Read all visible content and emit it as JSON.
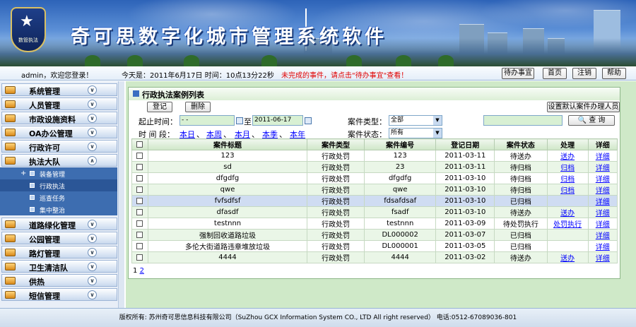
{
  "header": {
    "app_title": "奇可思数字化城市管理系统软件",
    "badge_text": "数管执法"
  },
  "topbar": {
    "welcome": "admin，欢迎您登录！",
    "date_text": "今天是：2011年6月17日  时间：10点13分22秒",
    "notice": "未完成的事件，请点击\"待办事宜\"查看！",
    "btn_todo": "待办事宜",
    "btn_home": "首页",
    "btn_logout": "注销",
    "btn_help": "帮助"
  },
  "sidebar": {
    "items": [
      {
        "label": "系统管理"
      },
      {
        "label": "人员管理"
      },
      {
        "label": "市政设施资料"
      },
      {
        "label": "OA办公管理"
      },
      {
        "label": "行政许可"
      },
      {
        "label": "执法大队"
      },
      {
        "label": "道路绿化管理"
      },
      {
        "label": "公园管理"
      },
      {
        "label": "路灯管理"
      },
      {
        "label": "卫生清洁队"
      },
      {
        "label": "供热"
      },
      {
        "label": "短信管理"
      }
    ],
    "subs": [
      {
        "label": "装备管理"
      },
      {
        "label": "行政执法"
      },
      {
        "label": "巡查任务"
      },
      {
        "label": "集中整治"
      }
    ]
  },
  "panel": {
    "title": "行政执法案例列表",
    "btn_register": "登记",
    "btn_delete": "删除",
    "btn_default_handler": "设置默认案件办理人员",
    "start_label": "起止时间：",
    "start_value": "- -",
    "to_label": "至",
    "end_value": "2011-06-17",
    "period_label": "时  间  段：",
    "periods": [
      "本日",
      "本周",
      "本月",
      "本季",
      "本年"
    ],
    "type_label": "案件类型：",
    "type_value": "全部",
    "status_label": "案件状态：",
    "status_value": "所有",
    "query_btn": "查 询"
  },
  "table": {
    "headers": [
      "案件标题",
      "案件类型",
      "案件编号",
      "登记日期",
      "案件状态",
      "处理",
      "详细"
    ],
    "rows": [
      [
        "123",
        "行政处罚",
        "123",
        "2011-03-11",
        "待送办",
        "送办",
        "详细"
      ],
      [
        "sd",
        "行政处罚",
        "23",
        "2011-03-11",
        "待归档",
        "归档",
        "详细"
      ],
      [
        "dfgdfg",
        "行政处罚",
        "dfgdfg",
        "2011-03-10",
        "待归档",
        "归档",
        "详细"
      ],
      [
        "qwe",
        "行政处罚",
        "qwe",
        "2011-03-10",
        "待归档",
        "归档",
        "详细"
      ],
      [
        "fvfsdfsf",
        "行政处罚",
        "fdsafdsaf",
        "2011-03-10",
        "已归档",
        "",
        "详细"
      ],
      [
        "dfasdf",
        "行政处罚",
        "fsadf",
        "2011-03-10",
        "待送办",
        "送办",
        "详细"
      ],
      [
        "testnnn",
        "行政处罚",
        "testnnn",
        "2011-03-09",
        "待处罚执行",
        "处罚执行",
        "详细"
      ],
      [
        "强制回收道路垃圾",
        "行政处罚",
        "DL000002",
        "2011-03-07",
        "已归档",
        "",
        "详细"
      ],
      [
        "多伦大街道路违章堆放垃圾",
        "行政处罚",
        "DL000001",
        "2011-03-05",
        "已归档",
        "",
        "详细"
      ],
      [
        "4444",
        "行政处罚",
        "4444",
        "2011-03-02",
        "待送办",
        "送办",
        "详细"
      ]
    ]
  },
  "pager": {
    "p1": "1",
    "p2": "2"
  },
  "footer": {
    "text": "版权所有: 苏州奇可思信息科技有限公司（SuZhou GCX Information System CO., LTD All right reserved）   电话:0512-67089036-801"
  }
}
